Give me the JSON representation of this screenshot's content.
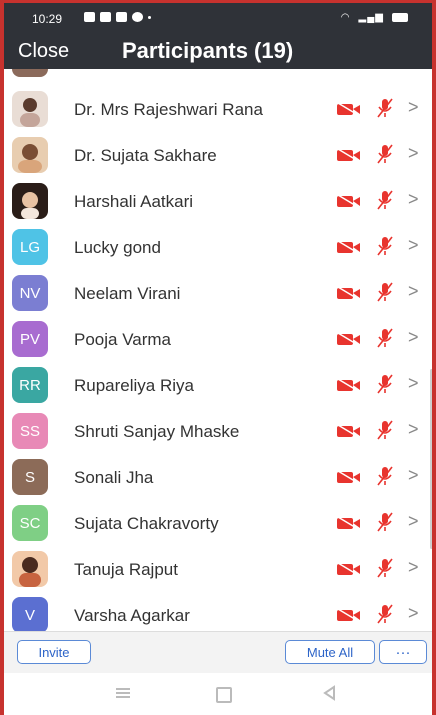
{
  "status_bar": {
    "time": "10:29"
  },
  "header": {
    "close_label": "Close",
    "title": "Participants (19)"
  },
  "participants": [
    {
      "name": "",
      "avatar_type": "photo",
      "avatar_color": "#8b6a5b"
    },
    {
      "name": "Dr. Mrs Rajeshwari Rana",
      "avatar_type": "photo",
      "avatar_color": "#d7c3b6"
    },
    {
      "name": "Dr. Sujata Sakhare",
      "avatar_type": "photo",
      "avatar_color": "#d9a57b"
    },
    {
      "name": "Harshali Aatkari",
      "avatar_type": "photo",
      "avatar_color": "#3b2a22"
    },
    {
      "name": "Lucky gond",
      "avatar_type": "initials",
      "initials": "LG",
      "avatar_color": "#4fc3e6"
    },
    {
      "name": "Neelam Virani",
      "avatar_type": "initials",
      "initials": "NV",
      "avatar_color": "#7b7ed2"
    },
    {
      "name": "Pooja Varma",
      "avatar_type": "initials",
      "initials": "PV",
      "avatar_color": "#a86cd0"
    },
    {
      "name": "Rupareliya Riya",
      "avatar_type": "initials",
      "initials": "RR",
      "avatar_color": "#3aa7a2"
    },
    {
      "name": "Shruti Sanjay Mhaske",
      "avatar_type": "initials",
      "initials": "SS",
      "avatar_color": "#e889b6"
    },
    {
      "name": "Sonali Jha",
      "avatar_type": "initials",
      "initials": "S",
      "avatar_color": "#8c6b58"
    },
    {
      "name": "Sujata Chakravorty",
      "avatar_type": "initials",
      "initials": "SC",
      "avatar_color": "#7fcf85"
    },
    {
      "name": "Tanuja Rajput",
      "avatar_type": "photo",
      "avatar_color": "#c7633f"
    },
    {
      "name": "Varsha Agarkar",
      "avatar_type": "initials",
      "initials": "V",
      "avatar_color": "#5b6fd1"
    }
  ],
  "footer": {
    "invite_label": "Invite",
    "mute_all_label": "Mute All",
    "more_label": "···"
  },
  "colors": {
    "header_bg": "#2f3238",
    "accent_red": "#e8342e",
    "button_blue": "#2d64c8"
  }
}
